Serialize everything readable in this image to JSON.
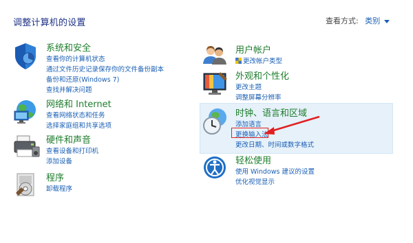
{
  "header": {
    "title": "调整计算机的设置",
    "view_by_label": "查看方式:",
    "view_by_value": "类别"
  },
  "left": [
    {
      "title": "系统和安全",
      "links": [
        "查看你的计算机状态",
        "通过文件历史记录保存你的文件备份副本",
        "备份和还原(Windows 7)",
        "查找并解决问题"
      ]
    },
    {
      "title": "网络和 Internet",
      "links": [
        "查看网络状态和任务",
        "选择家庭组和共享选项"
      ]
    },
    {
      "title": "硬件和声音",
      "links": [
        "查看设备和打印机",
        "添加设备"
      ]
    },
    {
      "title": "程序",
      "links": [
        "卸载程序"
      ]
    }
  ],
  "right": [
    {
      "title": "用户帐户",
      "links": [
        "更改帐户类型"
      ]
    },
    {
      "title": "外观和个性化",
      "links": [
        "更改主题",
        "调整屏幕分辨率"
      ]
    },
    {
      "title": "时钟、语言和区域",
      "links": [
        "添加语言",
        "更换输入法",
        "更改日期、时间或数字格式"
      ]
    },
    {
      "title": "轻松使用",
      "links": [
        "使用 Windows 建议的设置",
        "优化视觉显示"
      ]
    }
  ],
  "colors": {
    "category_title": "#1e7d2c",
    "link": "#1a5fb4",
    "highlight_bg": "#e6f1fa",
    "annotation_red": "#e02020"
  },
  "icons": [
    "shield-icon",
    "network-icon",
    "printer-icon",
    "programs-icon",
    "users-icon",
    "monitor-icon",
    "clock-globe-icon",
    "ease-of-access-icon"
  ]
}
